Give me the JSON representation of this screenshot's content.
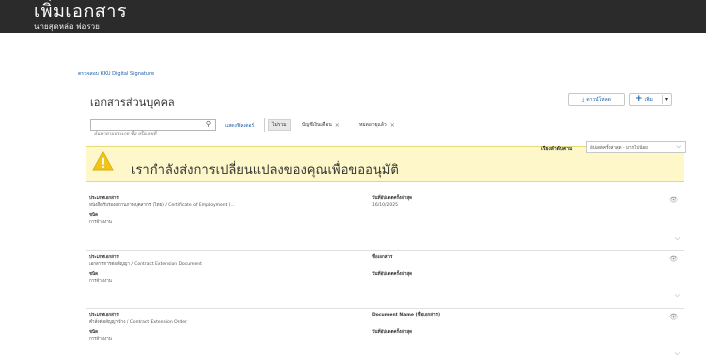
{
  "header": {
    "title": "เพิ่มเอกสาร",
    "user": "นายสุดหล่อ พ่อรวย"
  },
  "breadcrumb": "ตรวจสอบ KKU Digital Signature",
  "page_title": "เอกสารส่วนบุคคล",
  "toolbar": {
    "download_label": "ดาวน์โหลด",
    "add_label": "เพิ่ม"
  },
  "search": {
    "placeholder": "ค้นหาตามประเภท ชื่อ หรือเลขที่"
  },
  "filters": {
    "show_filters_label": "แสดงฟิลเตอร์",
    "chip_all": "ไม่รวม",
    "chips": [
      "บัญชีเงินเดือน",
      "หมดอายุแล้ว"
    ]
  },
  "sort": {
    "label": "เรียงลำดับตาม",
    "selected": "อัปเดตครั้งล่าสุด - มากไปน้อย"
  },
  "banner": {
    "message": "เรากำลังส่งการเปลี่ยนแปลงของคุณเพื่อขออนุมัติ"
  },
  "documents": [
    {
      "type_label": "ประเภทเอกสาร",
      "type_value": "หนังสือรับรองสถานภาพบุคลากร (ไทย) / Certificate of Employment (...",
      "category_label": "ชนิด",
      "category_value": "การจ้างงาน",
      "right_label_1": "วันที่อัปเดตครั้งล่าสุด",
      "right_value_1": "16/10/2025",
      "right_label_2": "",
      "right_value_2": ""
    },
    {
      "type_label": "ประเภทเอกสาร",
      "type_value": "เอกสารการต่อสัญญา / Contract Extension Document",
      "category_label": "ชนิด",
      "category_value": "การจ้างงาน",
      "right_label_1": "ชื่อเอกสาร",
      "right_value_1": "",
      "right_label_2": "วันที่อัปเดตครั้งล่าสุด",
      "right_value_2": ""
    },
    {
      "type_label": "ประเภทเอกสาร",
      "type_value": "คำสั่งต่อสัญญาจ้าง / Contract Extension Order",
      "category_label": "ชนิด",
      "category_value": "การจ้างงาน",
      "right_label_1": "Document Name (ชื่อเอกสาร)",
      "right_value_1": "",
      "right_label_2": "วันที่อัปเดตครั้งล่าสุด",
      "right_value_2": ""
    }
  ],
  "colors": {
    "accent": "#1a5fa8",
    "header_bg": "#2b2b2b",
    "banner_bg": "#fdf7c9",
    "warning": "#f0c419"
  },
  "icons": {
    "download": "download-icon",
    "add": "plus-icon",
    "search": "search-icon",
    "view": "eye-icon",
    "expand": "chevron-down-icon",
    "warning": "warning-icon"
  }
}
